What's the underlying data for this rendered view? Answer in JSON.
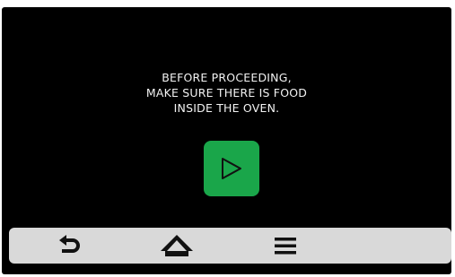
{
  "prompt": {
    "lines": [
      "BEFORE PROCEEDING,",
      "MAKE SURE THERE IS FOOD",
      "INSIDE THE OVEN."
    ]
  },
  "start_button": {
    "icon": "play-icon",
    "color": "#1aa64a"
  },
  "bottom_bar": {
    "color": "#d9d9d9",
    "items": [
      {
        "icon": "back-arrow-icon"
      },
      {
        "icon": "home-icon"
      },
      {
        "icon": "menu-icon"
      }
    ]
  },
  "colors": {
    "screen_background": "#000000",
    "text": "#f2f2f2",
    "icon": "#111111"
  }
}
